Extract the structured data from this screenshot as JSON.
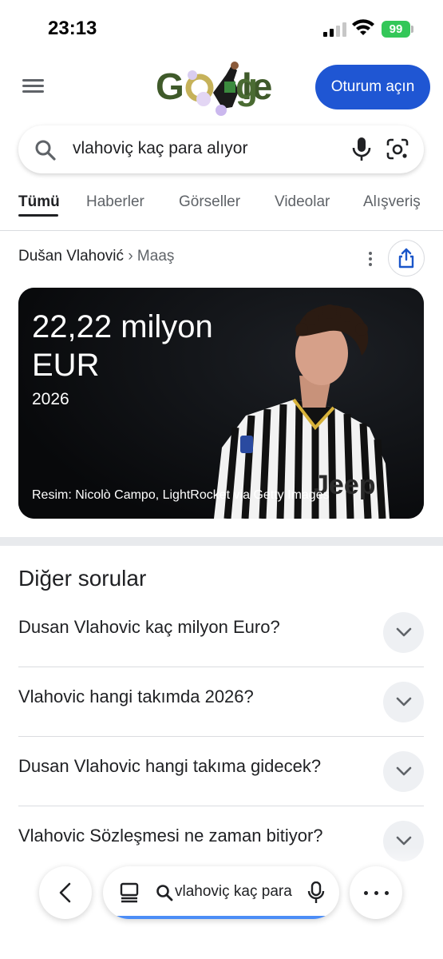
{
  "status_bar": {
    "time": "23:13",
    "battery": "99"
  },
  "header": {
    "signin_label": "Oturum açın"
  },
  "search": {
    "query": "vlahoviç kaç para alıyor"
  },
  "tabs": [
    {
      "label": "Tümü",
      "active": true
    },
    {
      "label": "Haberler"
    },
    {
      "label": "Görseller"
    },
    {
      "label": "Videolar"
    },
    {
      "label": "Alışveriş"
    }
  ],
  "result": {
    "breadcrumb_main": "Dušan Vlahović",
    "breadcrumb_sep": "›",
    "breadcrumb_sub": "Maaş",
    "amount": "22,22 milyon EUR",
    "year": "2026",
    "image_credit": "Resim: Nicolò Campo, LightRocket via Getty Images"
  },
  "paa": {
    "title": "Diğer sorular",
    "questions": [
      "Dusan Vlahovic kaç milyon Euro?",
      "Vlahovic hangi takımda 2026?",
      "Dusan Vlahovic hangi takıma gidecek?",
      "Vlahovic Sözleşmesi ne zaman bitiyor?"
    ]
  },
  "bottom_bar": {
    "query": "vlahoviç kaç para alıyor"
  },
  "colors": {
    "brand_blue": "#1f56d3",
    "battery_green": "#34c759",
    "progress_blue": "#4c8df6"
  }
}
